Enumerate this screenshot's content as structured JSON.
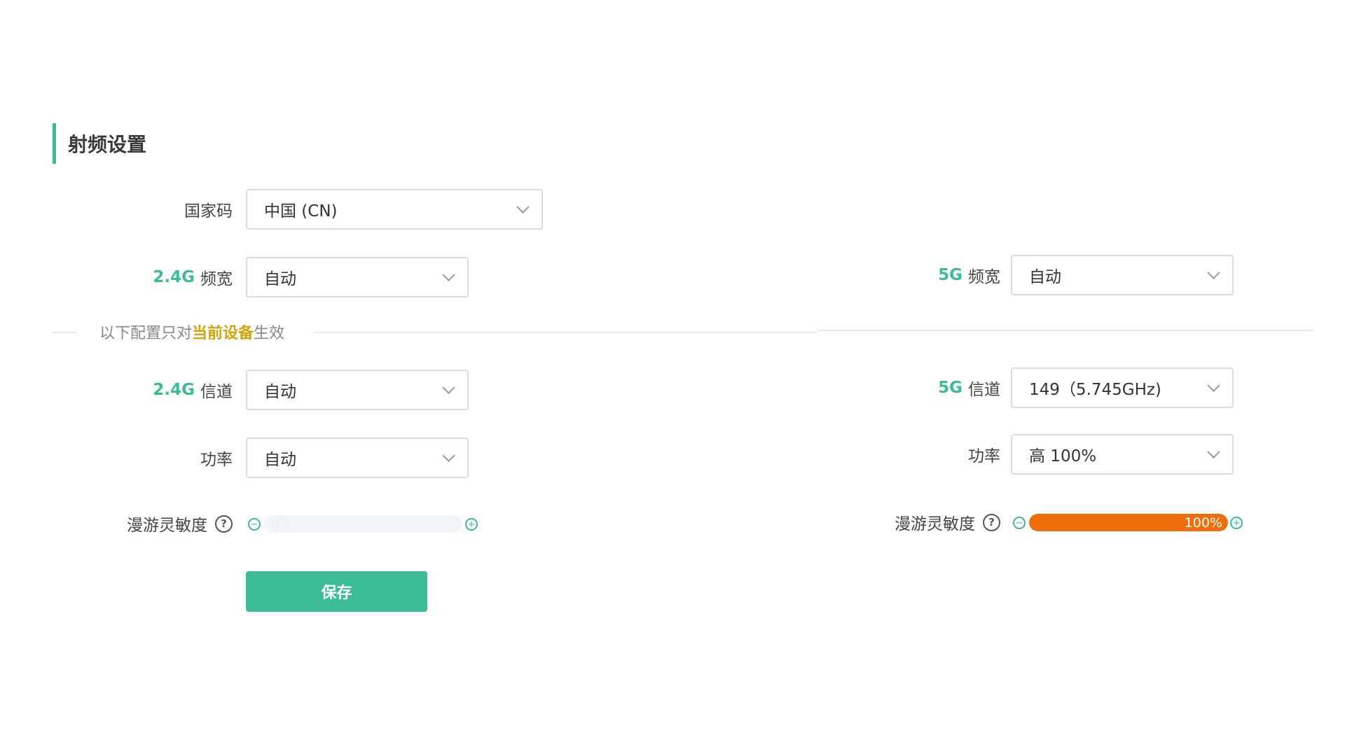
{
  "section": {
    "title": "射频设置"
  },
  "country": {
    "label": "国家码",
    "value": "中国 (CN)"
  },
  "band24": {
    "prefix": "2.4G",
    "width_label": "频宽",
    "width_value": "自动",
    "channel_label": "信道",
    "channel_value": "自动",
    "power_label": "功率",
    "power_value": "自动",
    "roam_label": "漫游灵敏度",
    "roam_percent": 0,
    "roam_text": "0%"
  },
  "band5": {
    "prefix": "5G",
    "width_label": "频宽",
    "width_value": "自动",
    "channel_label": "信道",
    "channel_value": "149（5.745GHz)",
    "power_label": "功率",
    "power_value": "高 100%",
    "roam_label": "漫游灵敏度",
    "roam_percent": 100,
    "roam_text": "100%"
  },
  "divider": {
    "prefix": "以下配置只对",
    "highlight": "当前设备",
    "suffix": "生效"
  },
  "icons": {
    "help": "?",
    "minus": "−",
    "plus": "+"
  },
  "actions": {
    "save_label": "保存"
  },
  "colors": {
    "accent": "#3bbc95",
    "highlight": "#d4a30a",
    "slider_high": "#ee6d0c",
    "slider_track": "#f1f5fa"
  }
}
